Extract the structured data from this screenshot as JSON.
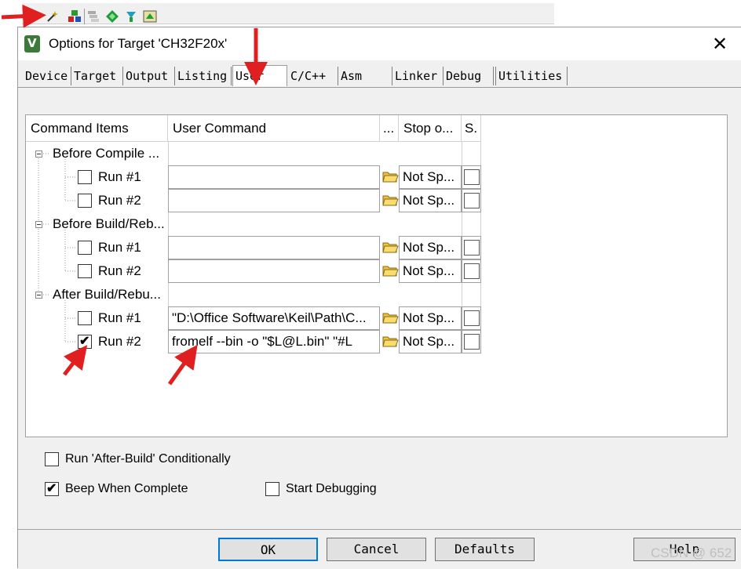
{
  "dialog": {
    "title": "Options for Target 'CH32F20x'",
    "close_glyph": "✕",
    "app_icon_letter": "V"
  },
  "toolbar": {
    "icons": [
      "magic-wand-icon",
      "component-icon",
      "stack-icon",
      "diamond-icon",
      "pack-install-icon",
      "pack-icon"
    ]
  },
  "tabs": [
    {
      "label": "Device"
    },
    {
      "label": "Target"
    },
    {
      "label": "Output"
    },
    {
      "label": "Listing"
    },
    {
      "label": "User",
      "active": true
    },
    {
      "label": "C/C++"
    },
    {
      "label": "Asm"
    },
    {
      "label": "Linker"
    },
    {
      "label": "Debug"
    },
    {
      "label": "Utilities"
    }
  ],
  "grid": {
    "headers": {
      "command_items": "Command Items",
      "user_command": "User Command",
      "browse": "...",
      "stop_on": "Stop o...",
      "s": "S."
    },
    "groups": [
      {
        "label": "Before Compile ...",
        "runs": [
          {
            "label": "Run #1",
            "checked": false,
            "command": "",
            "stop": "Not Sp..."
          },
          {
            "label": "Run #2",
            "checked": false,
            "command": "",
            "stop": "Not Sp..."
          }
        ]
      },
      {
        "label": "Before Build/Reb...",
        "runs": [
          {
            "label": "Run #1",
            "checked": false,
            "command": "",
            "stop": "Not Sp..."
          },
          {
            "label": "Run #2",
            "checked": false,
            "command": "",
            "stop": "Not Sp..."
          }
        ]
      },
      {
        "label": "After Build/Rebu...",
        "runs": [
          {
            "label": "Run #1",
            "checked": false,
            "command": "\"D:\\Office Software\\Keil\\Path\\C...",
            "stop": "Not Sp..."
          },
          {
            "label": "Run #2",
            "checked": true,
            "command": "fromelf --bin -o \"$L@L.bin\" \"#L",
            "stop": "Not Sp..."
          }
        ]
      }
    ]
  },
  "options": {
    "run_after_build": {
      "label": "Run 'After-Build' Conditionally",
      "checked": false
    },
    "beep": {
      "label": "Beep When Complete",
      "checked": true
    },
    "start_debugging": {
      "label": "Start Debugging",
      "checked": false
    }
  },
  "buttons": {
    "ok": "OK",
    "cancel": "Cancel",
    "defaults": "Defaults",
    "help": "Help"
  },
  "watermark": "CSDN @ 652",
  "colors": {
    "arrow": "#e02020",
    "default_button_border": "#0078d7"
  }
}
